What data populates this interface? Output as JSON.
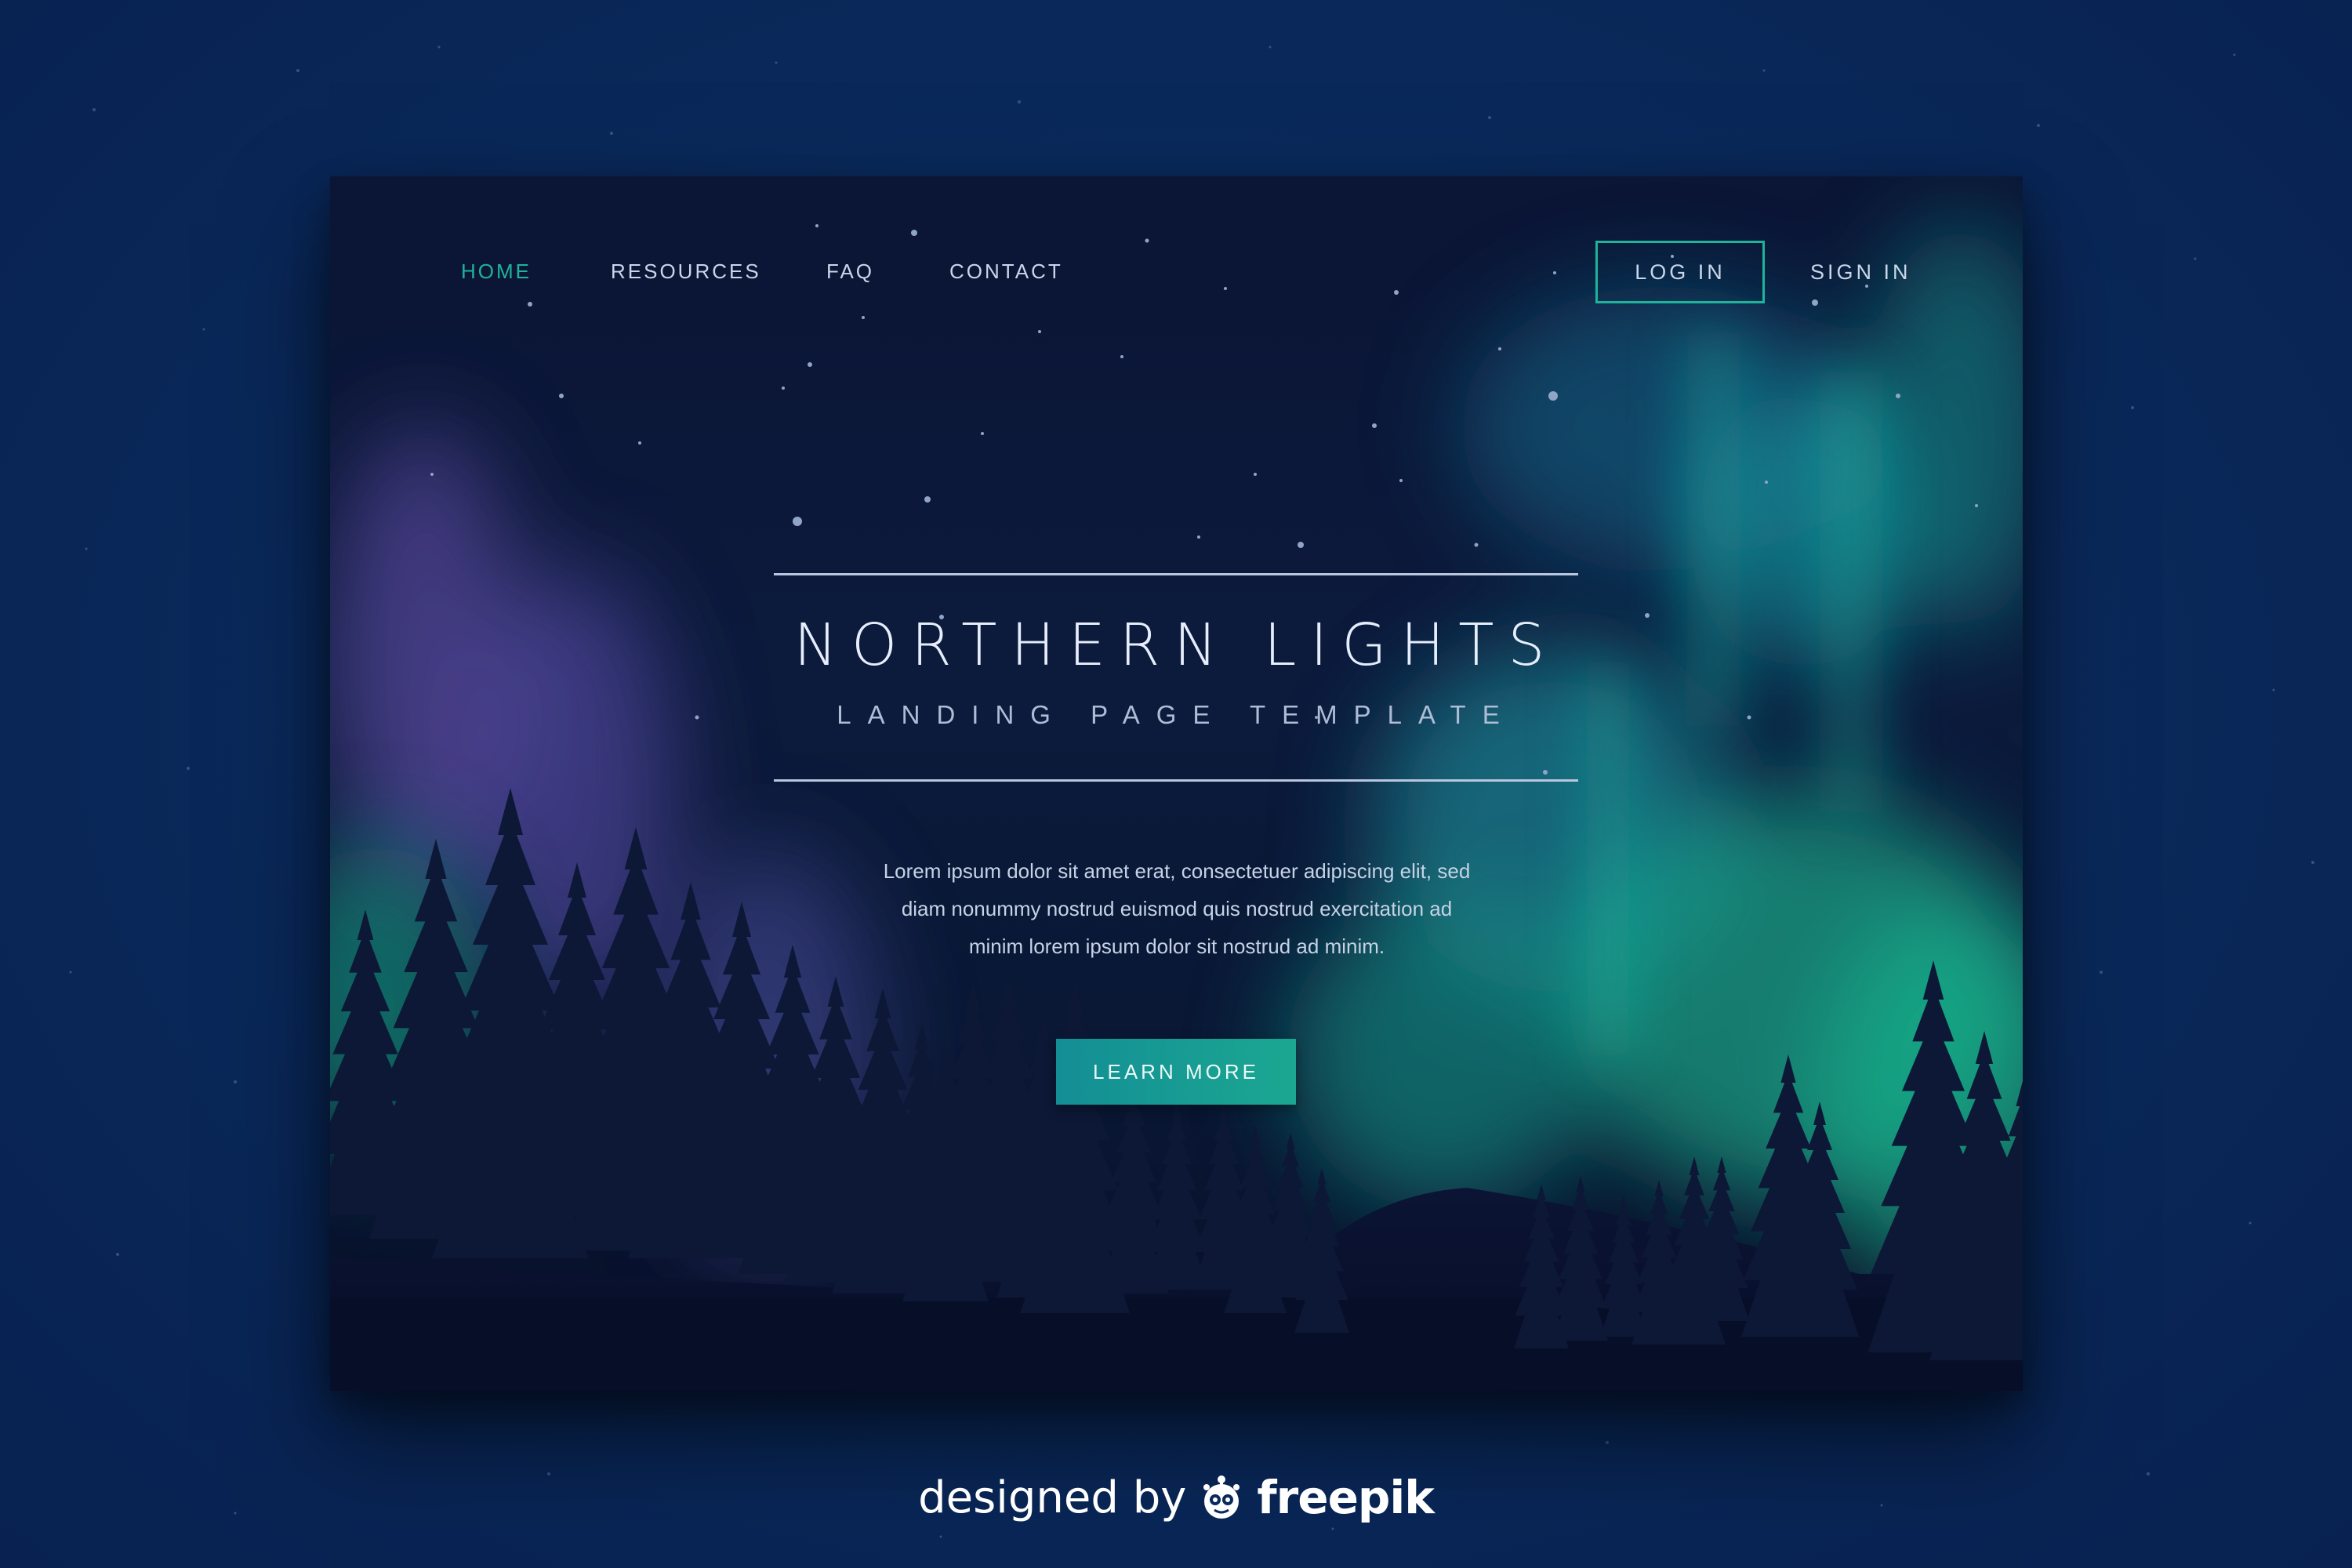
{
  "nav": {
    "items": [
      {
        "label": "HOME",
        "active": true
      },
      {
        "label": "RESOURCES",
        "active": false
      },
      {
        "label": "FAQ",
        "active": false
      },
      {
        "label": "CONTACT",
        "active": false
      }
    ],
    "login_label": "LOG IN",
    "signin_label": "SIGN IN"
  },
  "hero": {
    "title": "NORTHERN LIGHTS",
    "subtitle": "LANDING PAGE TEMPLATE",
    "description_lines": [
      "Lorem ipsum dolor sit amet erat, consectetuer adipiscing elit, sed",
      "diam nonummy nostrud euismod quis nostrud exercitation ad",
      "minim lorem ipsum dolor sit nostrud ad minim."
    ],
    "cta_label": "LEARN MORE"
  },
  "credit": {
    "prefix": "designed by",
    "brand": "freepik",
    "icon": "freepik-logo-icon"
  },
  "colors": {
    "accent": "#1fb39a",
    "sky": "#0b1535",
    "aurora_green": "#15b98e",
    "aurora_purple": "#7a5fc0",
    "page_bg": "#0a2a5c"
  }
}
